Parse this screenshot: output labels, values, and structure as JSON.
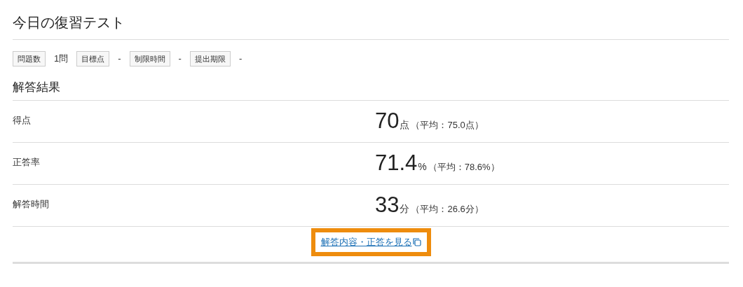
{
  "title": "今日の復習テスト",
  "info": [
    {
      "label": "問題数",
      "value": "1問"
    },
    {
      "label": "目標点",
      "value": "-"
    },
    {
      "label": "制限時間",
      "value": "-"
    },
    {
      "label": "提出期限",
      "value": "-"
    }
  ],
  "results_heading": "解答結果",
  "results": [
    {
      "label": "得点",
      "value": "70",
      "unit": "点",
      "average": "（平均：75.0点）"
    },
    {
      "label": "正答率",
      "value": "71.4",
      "unit": "%",
      "average": "（平均：78.6%）"
    },
    {
      "label": "解答時間",
      "value": "33",
      "unit": "分",
      "average": "（平均：26.6分）"
    }
  ],
  "link": {
    "text": "解答内容・正答を見る",
    "highlighted": true
  }
}
